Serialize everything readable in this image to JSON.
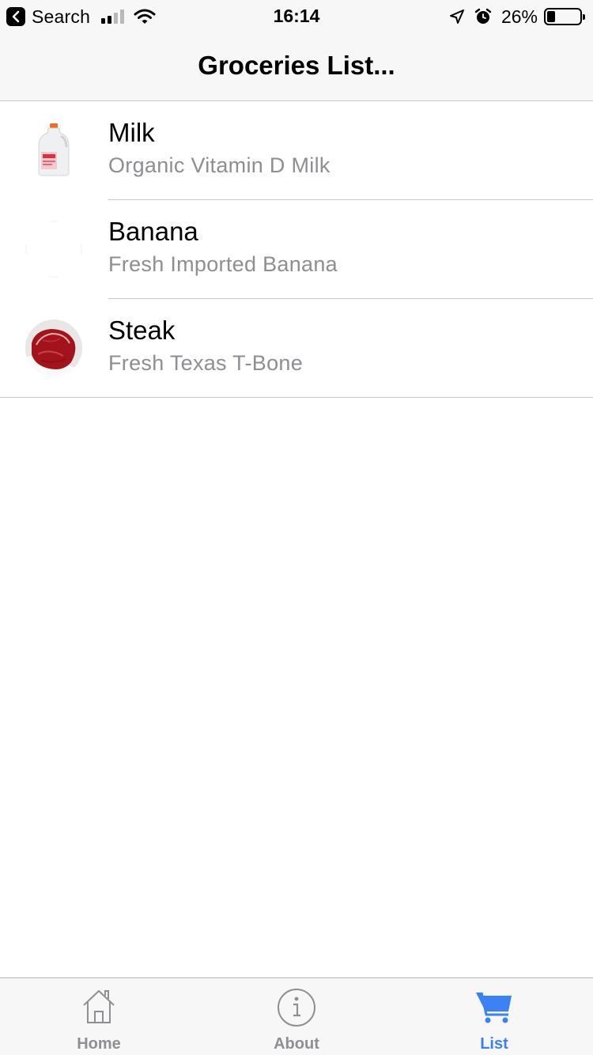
{
  "status_bar": {
    "back_label": "Search",
    "time": "16:14",
    "battery_percent": "26%",
    "battery_level": 0.26,
    "signal_bars_filled": 2,
    "signal_bars_total": 4
  },
  "nav": {
    "title": "Groceries List..."
  },
  "items": [
    {
      "title": "Milk",
      "subtitle": "Organic Vitamin D Milk",
      "icon": "milk-jug-image"
    },
    {
      "title": "Banana",
      "subtitle": "Fresh Imported Banana",
      "icon": "banana-image"
    },
    {
      "title": "Steak",
      "subtitle": "Fresh Texas T-Bone",
      "icon": "steak-image"
    }
  ],
  "tabs": [
    {
      "label": "Home",
      "icon": "house-icon",
      "active": false
    },
    {
      "label": "About",
      "icon": "info-icon",
      "active": false
    },
    {
      "label": "List",
      "icon": "cart-icon",
      "active": true
    }
  ],
  "colors": {
    "accent": "#3b82f6",
    "inactive_tab": "#8e8e93",
    "subtitle": "#8e8e93",
    "bar_background": "#f7f7f7"
  }
}
